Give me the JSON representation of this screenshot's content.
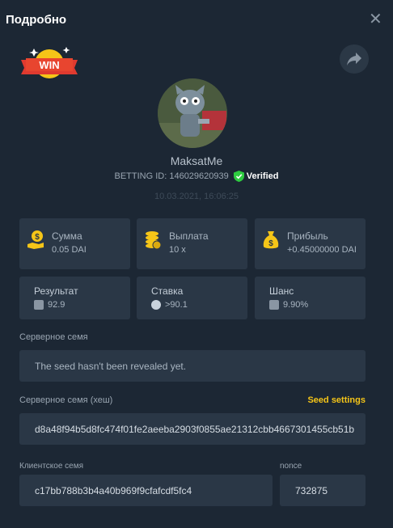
{
  "header": {
    "title": "Подробно",
    "close_symbol": "✕"
  },
  "badge": {
    "text": "WIN"
  },
  "user": {
    "name": "MaksatMe",
    "betting_id": "BETTING ID: 146029620939",
    "verified_label": "Verified",
    "datetime": "10.03.2021, 16:06:25"
  },
  "stats": {
    "amount": {
      "label": "Сумма",
      "value": "0.05 DAI"
    },
    "payout": {
      "label": "Выплата",
      "value": "10 x"
    },
    "profit": {
      "label": "Прибыль",
      "value": "+0.45000000 DAI"
    },
    "result": {
      "label": "Результат",
      "value": "92.9"
    },
    "bet": {
      "label": "Ставка",
      "value": ">90.1"
    },
    "chance": {
      "label": "Шанс",
      "value": "9.90%"
    }
  },
  "server_seed": {
    "label": "Серверное семя",
    "value": "The seed hasn't been revealed yet."
  },
  "server_seed_hash": {
    "label": "Серверное семя (хеш)",
    "settings_link": "Seed settings",
    "value": "d8a48f94b5d8fc474f01fe2aeeba2903f0855ae21312cbb4667301455cb51b"
  },
  "client_seed": {
    "label": "Клиентское семя",
    "value": "c17bb788b3b4a40b969f9cfafcdf5fc4"
  },
  "nonce": {
    "label": "nonce",
    "value": "732875"
  },
  "colors": {
    "background": "#1c2734",
    "card": "#2a3746",
    "accent_gold": "#f5c518",
    "verified_green": "#2ecc40"
  },
  "icons": {
    "close": "close-icon",
    "share": "share-icon",
    "amount": "money-hand-icon",
    "payout": "coins-stack-icon",
    "profit": "money-bag-icon",
    "result": "dice-icon",
    "bet": "bitcoin-coin-icon",
    "chance": "dice-icon"
  }
}
